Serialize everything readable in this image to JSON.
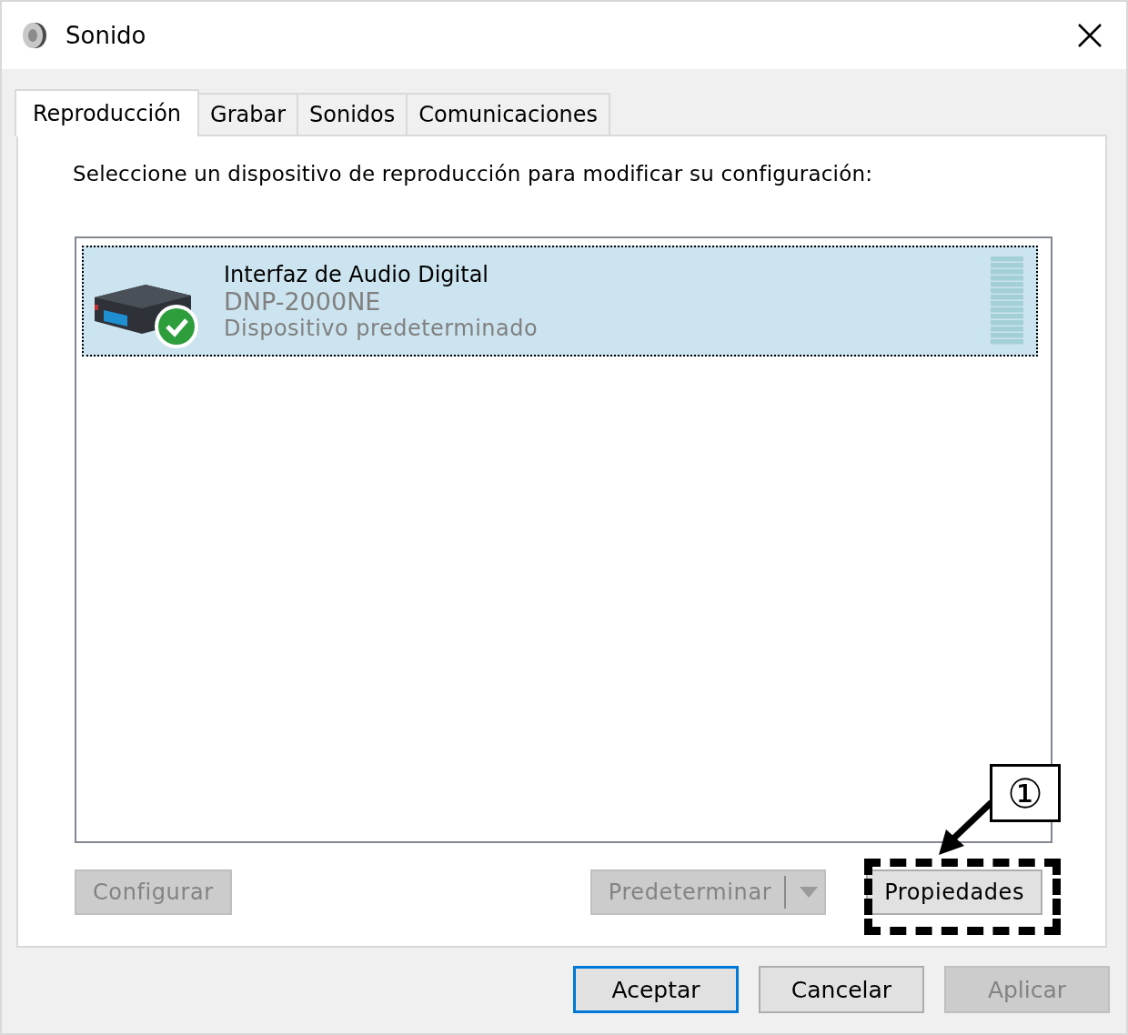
{
  "window": {
    "title": "Sonido"
  },
  "tabs": [
    {
      "label": "Reproducción",
      "selected": true
    },
    {
      "label": "Grabar",
      "selected": false
    },
    {
      "label": "Sonidos",
      "selected": false
    },
    {
      "label": "Comunicaciones",
      "selected": false
    }
  ],
  "instruction": "Seleccione un dispositivo de reproducción para modificar su configuración:",
  "devices": [
    {
      "name": "Interfaz de Audio Digital",
      "model": "DNP-2000NE",
      "status": "Dispositivo predeterminado",
      "selected": true,
      "default": true
    }
  ],
  "panel_buttons": [
    {
      "kind": "plain",
      "label": "Configurar",
      "disabled": true
    },
    {
      "kind": "split",
      "label": "Predeterminar",
      "disabled": true
    },
    {
      "kind": "plain",
      "label": "Propiedades",
      "disabled": false
    }
  ],
  "dialog_buttons": [
    {
      "label": "Aceptar",
      "default": true,
      "disabled": false
    },
    {
      "label": "Cancelar",
      "default": false,
      "disabled": false
    },
    {
      "label": "Aplicar",
      "default": false,
      "disabled": true
    }
  ],
  "annotation": {
    "label": "①"
  }
}
